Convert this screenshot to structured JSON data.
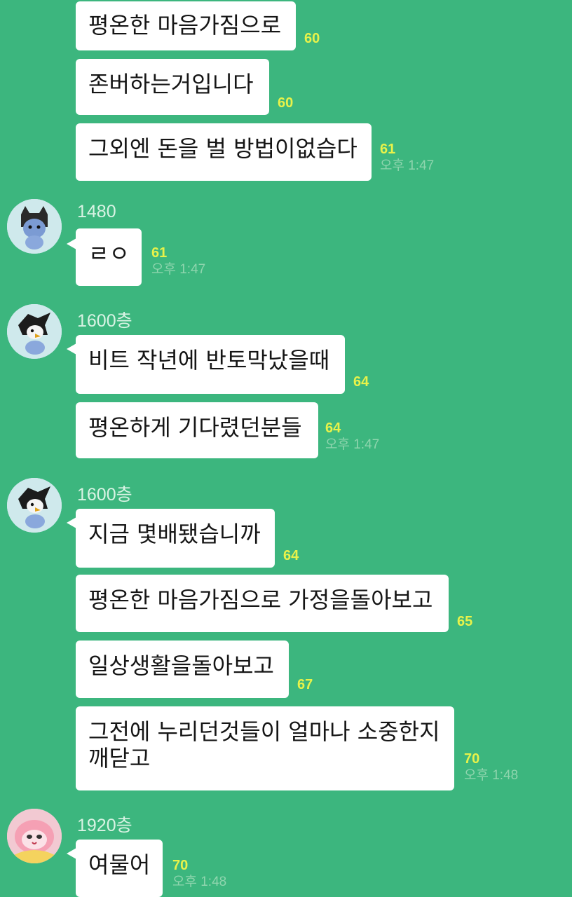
{
  "messages": [
    {
      "text": "평온한 마음가짐으로",
      "count": "60"
    },
    {
      "text": "존버하는거입니다",
      "count": "60"
    },
    {
      "text": "그외엔 돈을 벌 방법이없습다",
      "count": "61",
      "time": "오후 1:47"
    },
    {
      "text": "ㄹㅇ",
      "count": "61",
      "time": "오후 1:47",
      "sender": "1480"
    },
    {
      "text": "비트 작년에 반토막났을때",
      "count": "64",
      "sender": "1600층"
    },
    {
      "text": "평온하게 기다렸던분들",
      "count": "64",
      "time": "오후 1:47"
    },
    {
      "text": "지금 몇배됐습니까",
      "count": "64",
      "sender": "1600층"
    },
    {
      "text": "평온한 마음가짐으로 가정을돌아보고",
      "count": "65"
    },
    {
      "text": "일상생활을돌아보고",
      "count": "67"
    },
    {
      "text": "그전에 누리던것들이 얼마나 소중한지\n깨닫고",
      "text_line1": "그전에 누리던것들이 얼마나 소중한지",
      "text_line2": "깨닫고",
      "count": "70",
      "time": "오후 1:48"
    },
    {
      "text": "여물어",
      "count": "70",
      "time": "오후 1:48",
      "sender": "1920층"
    }
  ],
  "avatars": [
    {
      "icon": "cat-hood-character-icon",
      "bg": "#cfe9ec"
    },
    {
      "icon": "crow-character-icon",
      "bg": "#cfe9ec"
    },
    {
      "icon": "crow-character-icon",
      "bg": "#cfe9ec"
    },
    {
      "icon": "apeach-character-icon",
      "bg": "#f2c9d2"
    }
  ],
  "colors": {
    "background": "#3cb67e",
    "bubble": "#ffffff",
    "unread": "#e8f24a",
    "time": "#8fd5ae"
  }
}
